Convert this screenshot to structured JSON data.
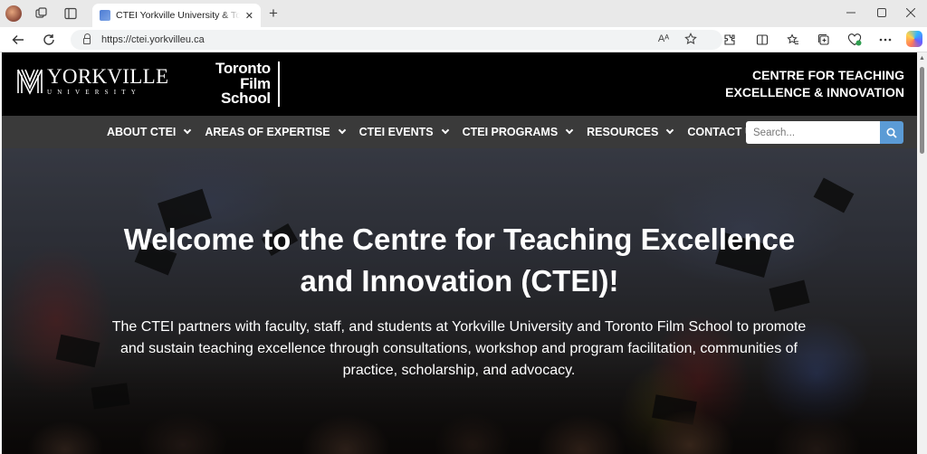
{
  "browser": {
    "tab_title": "CTEI Yorkville University & Toronto Film School",
    "tab_close": "✕",
    "new_tab": "+",
    "url": "https://ctei.yorkvilleu.ca",
    "read_aloud": "Aᴬ"
  },
  "header": {
    "yorkville_name": "YORKVILLE",
    "yorkville_sub": "UNIVERSITY",
    "tfs_lines": [
      "Toronto",
      "Film",
      "School"
    ],
    "ctei_line1": "CENTRE FOR TEACHING",
    "ctei_line2": "EXCELLENCE & INNOVATION"
  },
  "nav": {
    "items": [
      {
        "label": "ABOUT CTEI",
        "dropdown": true
      },
      {
        "label": "AREAS OF EXPERTISE",
        "dropdown": true
      },
      {
        "label": "CTEI EVENTS",
        "dropdown": true
      },
      {
        "label": "CTEI PROGRAMS",
        "dropdown": true
      },
      {
        "label": "RESOURCES",
        "dropdown": true
      },
      {
        "label": "CONTACT US",
        "dropdown": false
      }
    ],
    "search_placeholder": "Search..."
  },
  "hero": {
    "title_line1": "Welcome to the Centre for Teaching Excellence",
    "title_line2": "and Innovation (CTEI)!",
    "body": "The CTEI partners with faculty, staff, and students at Yorkville University and Toronto Film School to promote and sustain teaching excellence through consultations, workshop and program facilitation, communities of practice, scholarship, and advocacy."
  },
  "colors": {
    "header_bg": "#000000",
    "nav_bg": "#3a3a3a",
    "search_button": "#5b9bd5",
    "text": "#ffffff"
  },
  "icons": {
    "browser": [
      "profile-avatar",
      "workspaces-icon",
      "vertical-tabs-icon",
      "back-icon",
      "refresh-icon",
      "lock-icon",
      "read-aloud-icon",
      "favorite-star-icon",
      "extensions-icon",
      "split-screen-icon",
      "favorites-icon",
      "collections-icon",
      "browser-essentials-icon",
      "more-icon",
      "copilot-icon"
    ],
    "page": [
      "search-icon",
      "chevron-down-icon"
    ]
  }
}
